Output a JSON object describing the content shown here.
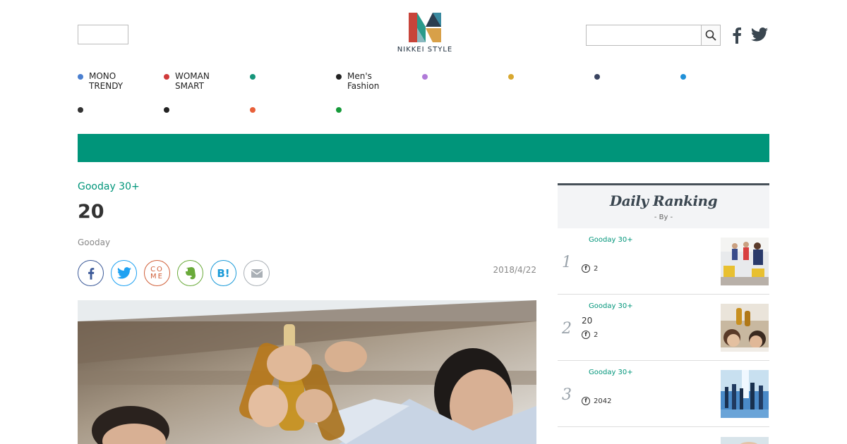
{
  "header": {
    "logo_text": "NIKKEI STYLE",
    "search_placeholder": "",
    "social": [
      "facebook-icon",
      "twitter-icon"
    ]
  },
  "nav": [
    {
      "label1": "MONO",
      "label2": "TRENDY",
      "color": "#4a7fd0"
    },
    {
      "label1": "WOMAN",
      "label2": "SMART",
      "color": "#d03a3a"
    },
    {
      "label1": "",
      "label2": "",
      "color": "#16957a"
    },
    {
      "label1": "Men's",
      "label2": "Fashion",
      "color": "#222222"
    },
    {
      "label1": "",
      "label2": "",
      "color": "#b07ad8"
    },
    {
      "label1": "",
      "label2": "",
      "color": "#d8a830"
    },
    {
      "label1": "",
      "label2": "",
      "color": "#3a4460"
    },
    {
      "label1": "",
      "label2": "",
      "color": "#2090d8"
    },
    {
      "label1": "",
      "label2": "",
      "color": "#333333"
    },
    {
      "label1": "",
      "label2": "",
      "color": "#222222"
    },
    {
      "label1": "",
      "label2": "",
      "color": "#e8603a"
    },
    {
      "label1": "",
      "label2": "",
      "color": "#169a3a"
    }
  ],
  "article": {
    "category": "Gooday 30+",
    "title": "20",
    "source": "Gooday",
    "date": "2018/4/22",
    "share": [
      "facebook-share-icon",
      "twitter-share-icon",
      "come-share-icon",
      "evernote-share-icon",
      "hatena-bookmark-icon",
      "mail-share-icon"
    ],
    "share_come": "CO\nME",
    "share_hatena": "B!"
  },
  "sidebar": {
    "title": "Daily Ranking",
    "subtitle": "- By  -",
    "items": [
      {
        "rank": "1",
        "category": "Gooday 30+",
        "title": "",
        "fb_count": "2"
      },
      {
        "rank": "2",
        "category": "Gooday 30+",
        "title": "20",
        "fb_count": "2"
      },
      {
        "rank": "3",
        "category": "Gooday 30+",
        "title": "",
        "fb_count": "2042"
      }
    ]
  },
  "colors": {
    "accent": "#00957a",
    "sidebar_border": "#465058"
  }
}
